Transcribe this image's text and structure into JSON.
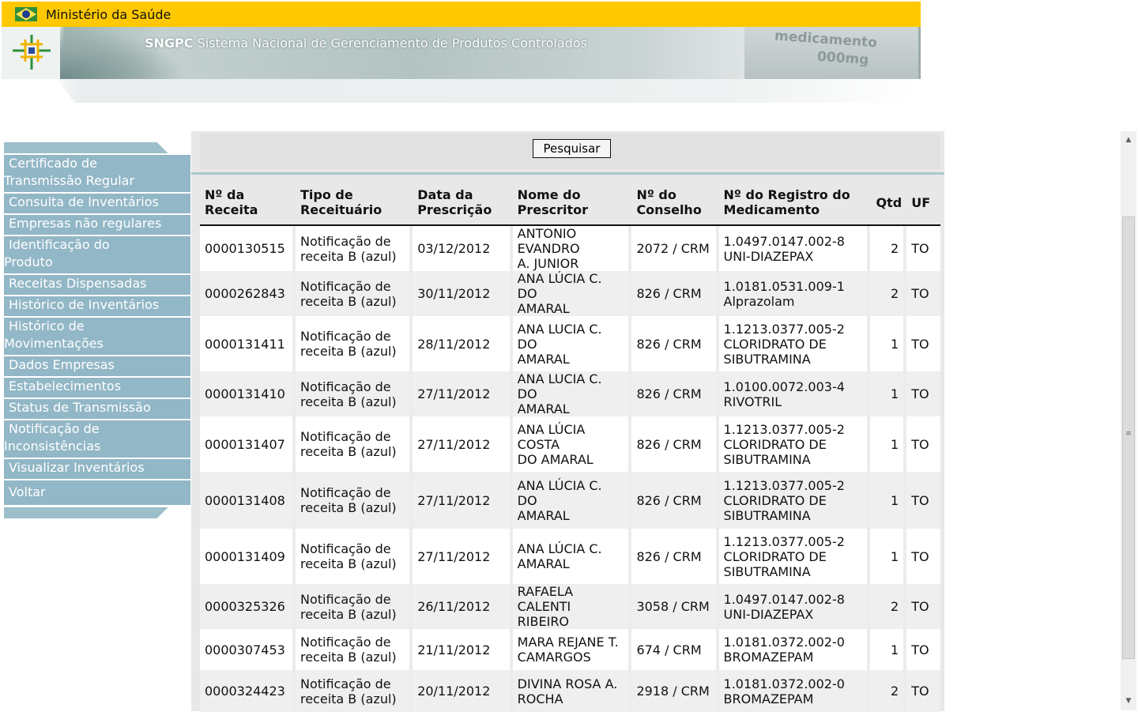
{
  "header": {
    "gov_name": "Ministério da Saúde",
    "app_short": "SNGPC",
    "app_full": "Sistema Nacional de Gerenciamento de Produtos Controlados",
    "product_line1": "medicamento",
    "product_line2": "000mg"
  },
  "sidebar": {
    "items": [
      {
        "line1": "Certificado de",
        "line2": "Transmissão Regular"
      },
      {
        "line1": "Consulta de Inventários",
        "line2": ""
      },
      {
        "line1": "Empresas não regulares",
        "line2": ""
      },
      {
        "line1": "Identificação do",
        "line2": "Produto"
      },
      {
        "line1": "Receitas Dispensadas",
        "line2": ""
      },
      {
        "line1": "Histórico de Inventários",
        "line2": ""
      },
      {
        "line1": "Histórico de",
        "line2": "Movimentações"
      },
      {
        "line1": "Dados Empresas",
        "line2": ""
      },
      {
        "line1": "Estabelecimentos",
        "line2": ""
      },
      {
        "line1": "Status de Transmissão",
        "line2": ""
      },
      {
        "line1": "Notificação de",
        "line2": "Inconsistências"
      },
      {
        "line1": "Visualizar Inventários",
        "line2": ""
      },
      {
        "line1": "Voltar",
        "line2": ""
      }
    ]
  },
  "search": {
    "button_label": "Pesquisar"
  },
  "table": {
    "headers": [
      {
        "line1": "Nº da",
        "line2": "Receita"
      },
      {
        "line1": "Tipo de",
        "line2": "Receituário"
      },
      {
        "line1": "Data da",
        "line2": "Prescrição"
      },
      {
        "line1": "Nome do",
        "line2": "Prescritor"
      },
      {
        "line1": "Nº do",
        "line2": "Conselho"
      },
      {
        "line1": "Nº do Registro do",
        "line2": "Medicamento"
      },
      {
        "line1": "Qtd",
        "line2": ""
      },
      {
        "line1": "UF",
        "line2": ""
      }
    ],
    "rows": [
      {
        "receita": "0000130515",
        "tipo": [
          "Notificação de",
          "receita B (azul)"
        ],
        "data": "03/12/2012",
        "prescritor": [
          "ANTONIO EVANDRO",
          "A. JUNIOR"
        ],
        "conselho": "2072 / CRM",
        "registro": [
          "1.0497.0147.002-8",
          "UNI-DIAZEPAX"
        ],
        "qtd": "2",
        "uf": "TO"
      },
      {
        "receita": "0000262843",
        "tipo": [
          "Notificação de",
          "receita B (azul)"
        ],
        "data": "30/11/2012",
        "prescritor": [
          "ANA LÚCIA C. DO",
          "AMARAL"
        ],
        "conselho": "826 / CRM",
        "registro": [
          "1.0181.0531.009-1",
          "Alprazolam"
        ],
        "qtd": "2",
        "uf": "TO"
      },
      {
        "receita": "0000131411",
        "tipo": [
          "Notificação de",
          "receita B (azul)"
        ],
        "data": "28/11/2012",
        "prescritor": [
          "ANA LUCIA C. DO",
          "AMARAL"
        ],
        "conselho": "826 / CRM",
        "registro": [
          "1.1213.0377.005-2",
          "CLORIDRATO DE",
          "SIBUTRAMINA"
        ],
        "qtd": "1",
        "uf": "TO"
      },
      {
        "receita": "0000131410",
        "tipo": [
          "Notificação de",
          "receita B (azul)"
        ],
        "data": "27/11/2012",
        "prescritor": [
          "ANA LUCIA C. DO",
          "AMARAL"
        ],
        "conselho": "826 / CRM",
        "registro": [
          "1.0100.0072.003-4",
          "RIVOTRIL"
        ],
        "qtd": "1",
        "uf": "TO"
      },
      {
        "receita": "0000131407",
        "tipo": [
          "Notificação de",
          "receita B (azul)"
        ],
        "data": "27/11/2012",
        "prescritor": [
          "ANA LÚCIA COSTA",
          "DO AMARAL"
        ],
        "conselho": "826 / CRM",
        "registro": [
          "1.1213.0377.005-2",
          "CLORIDRATO DE",
          "SIBUTRAMINA"
        ],
        "qtd": "1",
        "uf": "TO"
      },
      {
        "receita": "0000131408",
        "tipo": [
          "Notificação de",
          "receita B (azul)"
        ],
        "data": "27/11/2012",
        "prescritor": [
          "ANA LÚCIA C. DO",
          "AMARAL"
        ],
        "conselho": "826 / CRM",
        "registro": [
          "1.1213.0377.005-2",
          "CLORIDRATO DE",
          "SIBUTRAMINA"
        ],
        "qtd": "1",
        "uf": "TO"
      },
      {
        "receita": "0000131409",
        "tipo": [
          "Notificação de",
          "receita B (azul)"
        ],
        "data": "27/11/2012",
        "prescritor": [
          "ANA LÚCIA C.",
          "AMARAL"
        ],
        "conselho": "826 / CRM",
        "registro": [
          "1.1213.0377.005-2",
          "CLORIDRATO DE",
          "SIBUTRAMINA"
        ],
        "qtd": "1",
        "uf": "TO"
      },
      {
        "receita": "0000325326",
        "tipo": [
          "Notificação de",
          "receita B (azul)"
        ],
        "data": "26/11/2012",
        "prescritor": [
          "RAFAELA CALENTI",
          "RIBEIRO"
        ],
        "conselho": "3058 / CRM",
        "registro": [
          "1.0497.0147.002-8",
          "UNI-DIAZEPAX"
        ],
        "qtd": "2",
        "uf": "TO"
      },
      {
        "receita": "0000307453",
        "tipo": [
          "Notificação de",
          "receita B (azul)"
        ],
        "data": "21/11/2012",
        "prescritor": [
          "MARA REJANE T.",
          "CAMARGOS"
        ],
        "conselho": "674 / CRM",
        "registro": [
          "1.0181.0372.002-0",
          "BROMAZEPAM"
        ],
        "qtd": "1",
        "uf": "TO"
      },
      {
        "receita": "0000324423",
        "tipo": [
          "Notificação de",
          "receita B (azul)"
        ],
        "data": "20/11/2012",
        "prescritor": [
          "DIVINA ROSA A.",
          "ROCHA"
        ],
        "conselho": "2918 / CRM",
        "registro": [
          "1.0181.0372.002-0",
          "BROMAZEPAM"
        ],
        "qtd": "2",
        "uf": "TO"
      }
    ]
  },
  "colors": {
    "gov_bar": "#ffc800",
    "sidebar_item": "#92b7c6",
    "separator": "#a9c8cc"
  }
}
